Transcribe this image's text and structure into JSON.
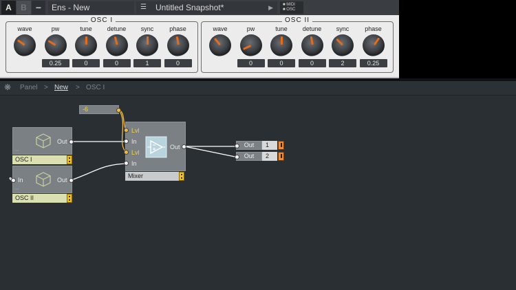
{
  "topbar": {
    "btn_a": "A",
    "btn_b": "B",
    "btn_minus": "−",
    "ensemble_title": "Ens - New",
    "snapshot_title": "Untitled Snapshot*",
    "midi_label": "MIDI",
    "osc_label": "OSC"
  },
  "panel": {
    "osc1": {
      "title": "OSC I",
      "knobs": [
        {
          "label": "wave",
          "value": ""
        },
        {
          "label": "pw",
          "value": "0.25"
        },
        {
          "label": "tune",
          "value": "0"
        },
        {
          "label": "detune",
          "value": "0"
        },
        {
          "label": "sync",
          "value": "1"
        },
        {
          "label": "phase",
          "value": "0"
        }
      ]
    },
    "osc2": {
      "title": "OSC II",
      "knobs": [
        {
          "label": "wave",
          "value": ""
        },
        {
          "label": "pw",
          "value": "0"
        },
        {
          "label": "tune",
          "value": "0"
        },
        {
          "label": "detune",
          "value": "0"
        },
        {
          "label": "sync",
          "value": "2"
        },
        {
          "label": "phase",
          "value": "0.25"
        }
      ]
    }
  },
  "breadcrumb": {
    "items": [
      "Panel",
      "New",
      "OSC I"
    ],
    "sep": ">"
  },
  "structure": {
    "osc1_module": {
      "label": "OSC I",
      "out": "Out"
    },
    "osc2_module": {
      "label": "OSC II",
      "in": "In",
      "out": "Out"
    },
    "constant": {
      "value": "-6"
    },
    "mixer": {
      "label": "Mixer",
      "lvl1": "Lvl",
      "in1": "In",
      "lvl2": "Lvl",
      "in2": "In",
      "out": "Out"
    },
    "outputs": [
      {
        "label": "Out",
        "channel": "1"
      },
      {
        "label": "Out",
        "channel": "2"
      }
    ]
  },
  "colors": {
    "accent_orange": "#e36d1d",
    "yellow_port": "#f2b93a",
    "canvas_bg": "#2a2f33"
  }
}
